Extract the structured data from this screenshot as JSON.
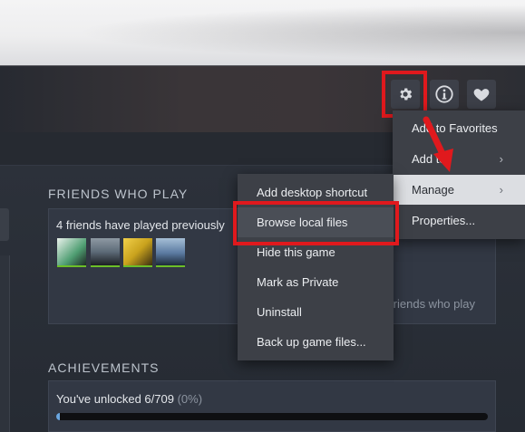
{
  "toolbar": {
    "settings_icon": "gear-icon",
    "info_icon": "info-icon",
    "favorite_icon": "heart-icon"
  },
  "friends": {
    "title": "FRIENDS WHO PLAY",
    "summary": "4 friends have played previously",
    "view_all": "friends who play",
    "avatar_colors": [
      "#4f9e72",
      "#5d6b78",
      "#c9a21d",
      "#5b7aa1"
    ]
  },
  "achievements": {
    "title": "ACHIEVEMENTS",
    "unlocked": "You've unlocked 6/709",
    "percent": "(0%)",
    "progress": 0.008
  },
  "main_menu": {
    "items": [
      {
        "label": "Add to Favorites"
      },
      {
        "label": "Add to",
        "has_submenu": true
      },
      {
        "label": "Manage",
        "has_submenu": true
      },
      {
        "label": "Properties..."
      }
    ]
  },
  "manage_menu": {
    "items": [
      {
        "label": "Add desktop shortcut"
      },
      {
        "label": "Browse local files"
      },
      {
        "label": "Hide this game"
      },
      {
        "label": "Mark as Private"
      },
      {
        "label": "Uninstall"
      },
      {
        "label": "Back up game files..."
      }
    ]
  },
  "colors": {
    "highlight": "#e0191d",
    "accent_green": "#6cbf28",
    "progress": "#6aa6e0"
  }
}
